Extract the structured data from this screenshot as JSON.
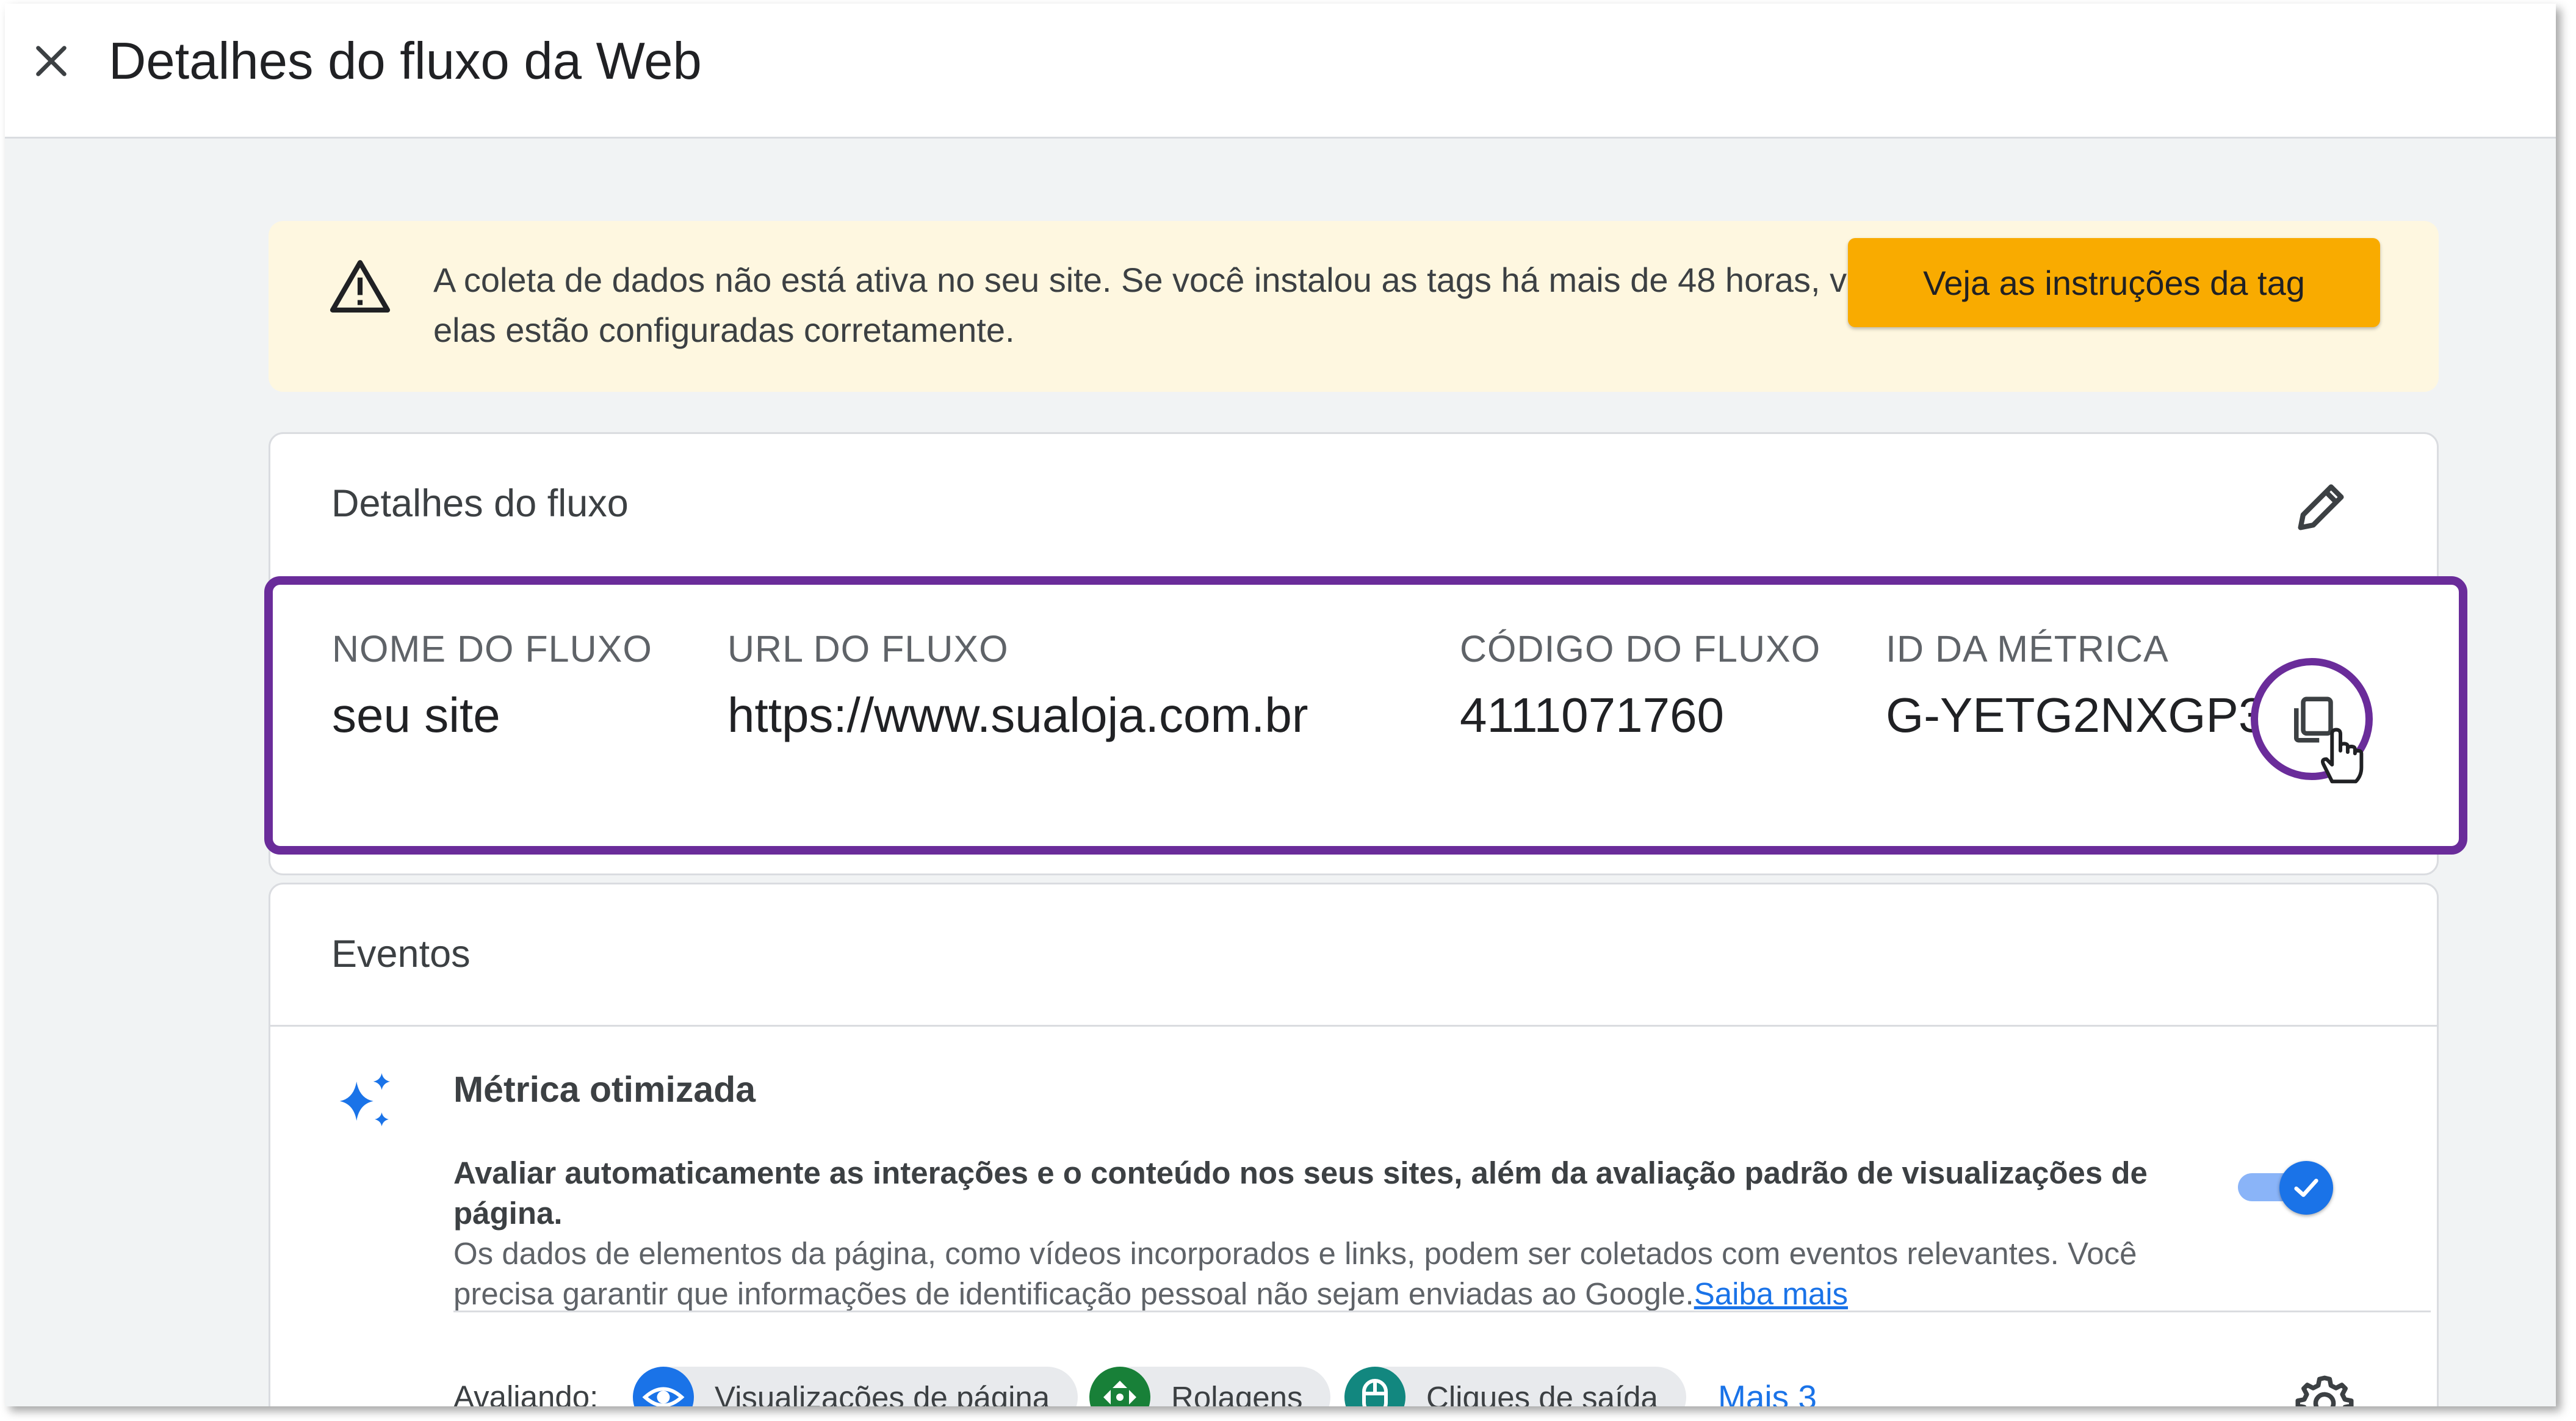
{
  "header": {
    "title": "Detalhes do fluxo da Web",
    "close_icon": "close-icon"
  },
  "banner": {
    "icon": "warning-icon",
    "text": "A coleta de dados não está ativa no seu site. Se você instalou as tags há mais de 48 horas, verifique se elas estão configuradas corretamente.",
    "button_label": "Veja as instruções da tag",
    "button_color": "#f9ab00",
    "background": "#fef7e0"
  },
  "stream_details": {
    "title": "Detalhes do fluxo",
    "edit_icon": "pencil-icon",
    "highlight_color": "#6a2c9a",
    "columns": [
      {
        "label": "NOME DO FLUXO",
        "value": "seu site"
      },
      {
        "label": "URL DO FLUXO",
        "value": "https://www.sualoja.com.br"
      },
      {
        "label": "CÓDIGO DO FLUXO",
        "value": "4111071760"
      },
      {
        "label": "ID DA MÉTRICA",
        "value": "G-YETG2NXGP3"
      }
    ],
    "copy_icon": "copy-icon",
    "cursor_icon": "hand-cursor-icon"
  },
  "events": {
    "title": "Eventos",
    "enhanced": {
      "icon": "sparkle-icon",
      "title": "Métrica otimizada",
      "description_bold": "Avaliar automaticamente as interações e o conteúdo nos seus sites, além da avaliação padrão de visualizações de página.",
      "description": "Os dados de elementos da página, como vídeos incorporados e links, podem ser coletados com eventos relevantes. Você precisa garantir que informações de identificação pessoal não sejam enviadas ao Google.",
      "learn_more": "Saiba mais",
      "toggle_on": true
    },
    "measuring_label": "Avaliando:",
    "chips": [
      {
        "label": "Visualizações de página",
        "icon": "eye-icon",
        "color": "#1a73e8"
      },
      {
        "label": "Rolagens",
        "icon": "scroll-icon",
        "color": "#188038"
      },
      {
        "label": "Cliques de saída",
        "icon": "mouse-icon",
        "color": "#12877f"
      }
    ],
    "more_label": "Mais 3",
    "settings_icon": "gear-icon"
  }
}
